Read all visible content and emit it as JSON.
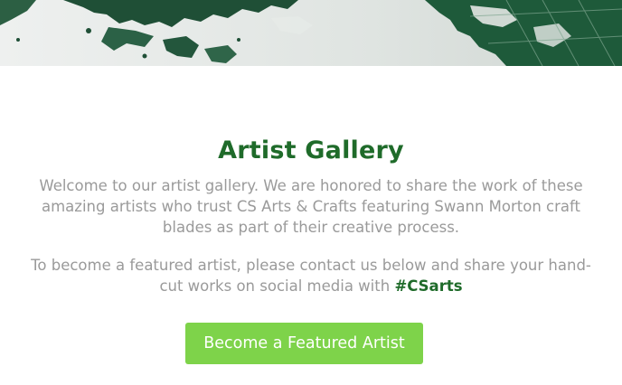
{
  "gallery": {
    "title": "Artist Gallery",
    "intro_text": "Welcome to our artist gallery. We are honored to share the work of these amazing artists who trust CS Arts & Crafts  featuring Swann Morton craft blades as part of their creative process.",
    "cta_text": "To become a featured artist, please contact us below and share your hand-cut works on social media with",
    "hashtag": "#CSarts",
    "button_label": "Become a Featured Artist"
  },
  "colors": {
    "title": "#1f6b2a",
    "body_text": "#9a9a9a",
    "hashtag": "#1f6b2a",
    "button_bg": "#7ed34a",
    "button_text": "#ffffff",
    "banner_dark": "#1e5a3a"
  }
}
